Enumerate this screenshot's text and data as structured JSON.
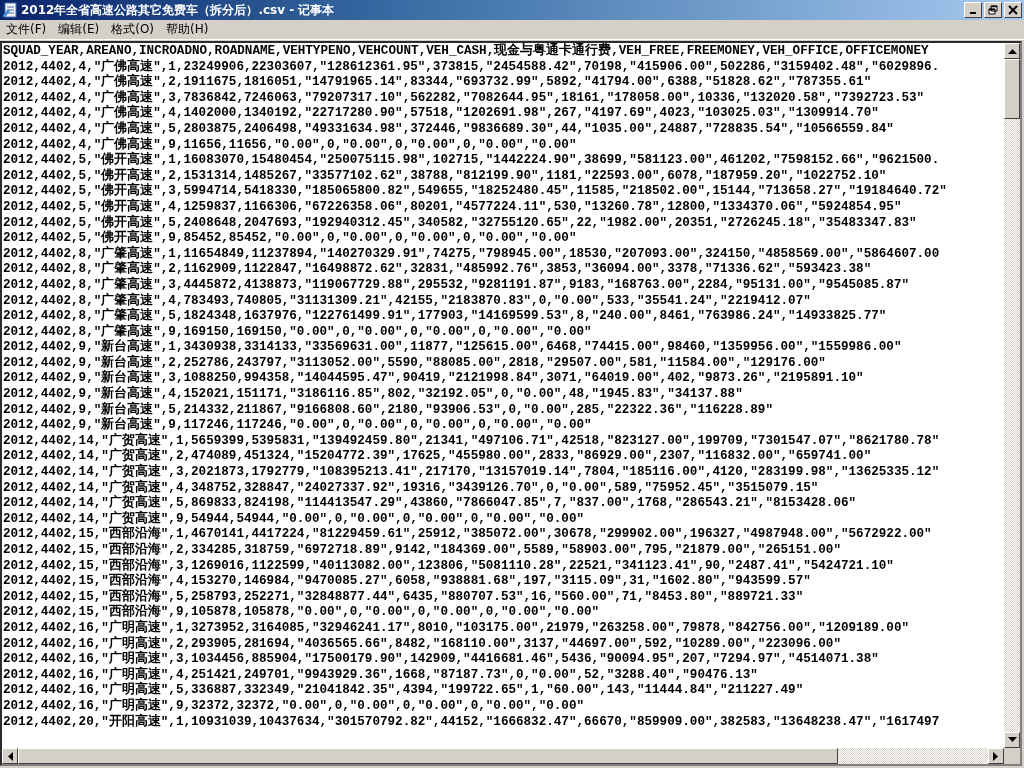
{
  "window": {
    "title": "2012年全省高速公路其它免费车（拆分后）.csv - 记事本"
  },
  "menu": [
    "文件(F)",
    "编辑(E)",
    "格式(O)",
    "帮助(H)"
  ],
  "lines": [
    "SQUAD_YEAR,AREANO,INCROADNO,ROADNAME,VEHTYPENO,VEHCOUNT,VEH_CASH,现金与粤通卡通行费,VEH_FREE,FREEMONEY,VEH_OFFICE,OFFICEMONEY",
    "2012,4402,4,\"广佛高速\",1,23249906,22303607,\"128612361.95\",373815,\"2454588.42\",70198,\"415906.00\",502286,\"3159402.48\",\"6029896.",
    "2012,4402,4,\"广佛高速\",2,1911675,1816051,\"14791965.14\",83344,\"693732.99\",5892,\"41794.00\",6388,\"51828.62\",\"787355.61\"",
    "2012,4402,4,\"广佛高速\",3,7836842,7246063,\"79207317.10\",562282,\"7082644.95\",18161,\"178058.00\",10336,\"132020.58\",\"7392723.53\"",
    "2012,4402,4,\"广佛高速\",4,1402000,1340192,\"22717280.90\",57518,\"1202691.98\",267,\"4197.69\",4023,\"103025.03\",\"1309914.70\"",
    "2012,4402,4,\"广佛高速\",5,2803875,2406498,\"49331634.98\",372446,\"9836689.30\",44,\"1035.00\",24887,\"728835.54\",\"10566559.84\"",
    "2012,4402,4,\"广佛高速\",9,11656,11656,\"0.00\",0,\"0.00\",0,\"0.00\",0,\"0.00\",\"0.00\"",
    "2012,4402,5,\"佛开高速\",1,16083070,15480454,\"250075115.98\",102715,\"1442224.90\",38699,\"581123.00\",461202,\"7598152.66\",\"9621500.",
    "2012,4402,5,\"佛开高速\",2,1531314,1485267,\"33577102.62\",38788,\"812199.90\",1181,\"22593.00\",6078,\"187959.20\",\"1022752.10\"",
    "2012,4402,5,\"佛开高速\",3,5994714,5418330,\"185065800.82\",549655,\"18252480.45\",11585,\"218502.00\",15144,\"713658.27\",\"19184640.72\"",
    "2012,4402,5,\"佛开高速\",4,1259837,1166306,\"67226358.06\",80201,\"4577224.11\",530,\"13260.78\",12800,\"1334370.06\",\"5924854.95\"",
    "2012,4402,5,\"佛开高速\",5,2408648,2047693,\"192940312.45\",340582,\"32755120.65\",22,\"1982.00\",20351,\"2726245.18\",\"35483347.83\"",
    "2012,4402,5,\"佛开高速\",9,85452,85452,\"0.00\",0,\"0.00\",0,\"0.00\",0,\"0.00\",\"0.00\"",
    "2012,4402,8,\"广肇高速\",1,11654849,11237894,\"140270329.91\",74275,\"798945.00\",18530,\"207093.00\",324150,\"4858569.00\",\"5864607.00",
    "2012,4402,8,\"广肇高速\",2,1162909,1122847,\"16498872.62\",32831,\"485992.76\",3853,\"36094.00\",3378,\"71336.62\",\"593423.38\"",
    "2012,4402,8,\"广肇高速\",3,4445872,4138873,\"119067729.88\",295532,\"9281191.87\",9183,\"168763.00\",2284,\"95131.00\",\"9545085.87\"",
    "2012,4402,8,\"广肇高速\",4,783493,740805,\"31131309.21\",42155,\"2183870.83\",0,\"0.00\",533,\"35541.24\",\"2219412.07\"",
    "2012,4402,8,\"广肇高速\",5,1824348,1637976,\"122761499.91\",177903,\"14169599.53\",8,\"240.00\",8461,\"763986.24\",\"14933825.77\"",
    "2012,4402,8,\"广肇高速\",9,169150,169150,\"0.00\",0,\"0.00\",0,\"0.00\",0,\"0.00\",\"0.00\"",
    "2012,4402,9,\"新台高速\",1,3430938,3314133,\"33569631.00\",11877,\"125615.00\",6468,\"74415.00\",98460,\"1359956.00\",\"1559986.00\"",
    "2012,4402,9,\"新台高速\",2,252786,243797,\"3113052.00\",5590,\"88085.00\",2818,\"29507.00\",581,\"11584.00\",\"129176.00\"",
    "2012,4402,9,\"新台高速\",3,1088250,994358,\"14044595.47\",90419,\"2121998.84\",3071,\"64019.00\",402,\"9873.26\",\"2195891.10\"",
    "2012,4402,9,\"新台高速\",4,152021,151171,\"3186116.85\",802,\"32192.05\",0,\"0.00\",48,\"1945.83\",\"34137.88\"",
    "2012,4402,9,\"新台高速\",5,214332,211867,\"9166808.60\",2180,\"93906.53\",0,\"0.00\",285,\"22322.36\",\"116228.89\"",
    "2012,4402,9,\"新台高速\",9,117246,117246,\"0.00\",0,\"0.00\",0,\"0.00\",0,\"0.00\",\"0.00\"",
    "2012,4402,14,\"广贺高速\",1,5659399,5395831,\"139492459.80\",21341,\"497106.71\",42518,\"823127.00\",199709,\"7301547.07\",\"8621780.78\"",
    "2012,4402,14,\"广贺高速\",2,474089,451324,\"15204772.39\",17625,\"455980.00\",2833,\"86929.00\",2307,\"116832.00\",\"659741.00\"",
    "2012,4402,14,\"广贺高速\",3,2021873,1792779,\"108395213.41\",217170,\"13157019.14\",7804,\"185116.00\",4120,\"283199.98\",\"13625335.12\"",
    "2012,4402,14,\"广贺高速\",4,348752,328847,\"24027337.92\",19316,\"3439126.70\",0,\"0.00\",589,\"75952.45\",\"3515079.15\"",
    "2012,4402,14,\"广贺高速\",5,869833,824198,\"114413547.29\",43860,\"7866047.85\",7,\"837.00\",1768,\"286543.21\",\"8153428.06\"",
    "2012,4402,14,\"广贺高速\",9,54944,54944,\"0.00\",0,\"0.00\",0,\"0.00\",0,\"0.00\",\"0.00\"",
    "2012,4402,15,\"西部沿海\",1,4670141,4417224,\"81229459.61\",25912,\"385072.00\",30678,\"299902.00\",196327,\"4987948.00\",\"5672922.00\"",
    "2012,4402,15,\"西部沿海\",2,334285,318759,\"6972718.89\",9142,\"184369.00\",5589,\"58903.00\",795,\"21879.00\",\"265151.00\"",
    "2012,4402,15,\"西部沿海\",3,1269016,1122599,\"40113082.00\",123806,\"5081110.28\",22521,\"341123.41\",90,\"2487.41\",\"5424721.10\"",
    "2012,4402,15,\"西部沿海\",4,153270,146984,\"9470085.27\",6058,\"938881.68\",197,\"3115.09\",31,\"1602.80\",\"943599.57\"",
    "2012,4402,15,\"西部沿海\",5,258793,252271,\"32848877.44\",6435,\"880707.53\",16,\"560.00\",71,\"8453.80\",\"889721.33\"",
    "2012,4402,15,\"西部沿海\",9,105878,105878,\"0.00\",0,\"0.00\",0,\"0.00\",0,\"0.00\",\"0.00\"",
    "2012,4402,16,\"广明高速\",1,3273952,3164085,\"32946241.17\",8010,\"103175.00\",21979,\"263258.00\",79878,\"842756.00\",\"1209189.00\"",
    "2012,4402,16,\"广明高速\",2,293905,281694,\"4036565.66\",8482,\"168110.00\",3137,\"44697.00\",592,\"10289.00\",\"223096.00\"",
    "2012,4402,16,\"广明高速\",3,1034456,885904,\"17500179.90\",142909,\"4416681.46\",5436,\"90094.95\",207,\"7294.97\",\"4514071.38\"",
    "2012,4402,16,\"广明高速\",4,251421,249701,\"9943929.36\",1668,\"87187.73\",0,\"0.00\",52,\"3288.40\",\"90476.13\"",
    "2012,4402,16,\"广明高速\",5,336887,332349,\"21041842.35\",4394,\"199722.65\",1,\"60.00\",143,\"11444.84\",\"211227.49\"",
    "2012,4402,16,\"广明高速\",9,32372,32372,\"0.00\",0,\"0.00\",0,\"0.00\",0,\"0.00\",\"0.00\"",
    "2012,4402,20,\"开阳高速\",1,10931039,10437634,\"301570792.82\",44152,\"1666832.47\",66670,\"859909.00\",382583,\"13648238.47\",\"1617497"
  ]
}
